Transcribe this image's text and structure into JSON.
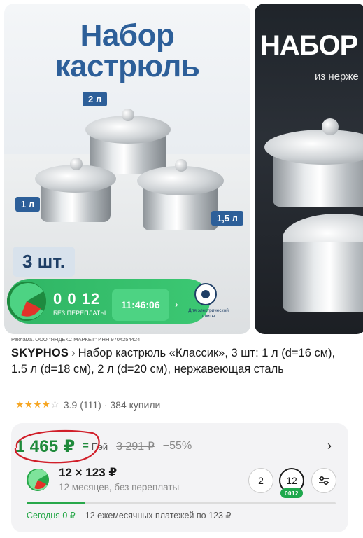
{
  "gallery": {
    "slide1": {
      "title_line1": "Набор",
      "title_line2": "кастрюль",
      "size_tags": [
        "2 л",
        "1 л",
        "1,5 л"
      ],
      "pieces": "3 шт.",
      "promo": {
        "installments_count": "0 0 12",
        "installments_subtitle": "БЕЗ ПЕРЕПЛАТЫ",
        "timer": "11:46:06",
        "plate_label": "Для электрической плиты"
      }
    },
    "slide2": {
      "title": "НАБОР К",
      "subtitle": "из нерже"
    }
  },
  "ad_disclaimer": "Реклама. ООО \"ЯНДЕКС МАРКЕТ\" ИНН 9704254424",
  "product": {
    "brand": "SKYPHOS",
    "breadcrumb_sep": "›",
    "title": "Набор кастрюль «Классик», 3 шт: 1 л (d=16 см), 1.5 л (d=18 см), 2 л (d=20 см), нержавеющая сталь",
    "rating": {
      "value": 3.9,
      "value_text": "3.9",
      "reviews": "(111)",
      "bought": "· 384 купили"
    }
  },
  "price": {
    "current": "1 465 ₽",
    "pay_label": "Пэй",
    "old": "3 291 ₽",
    "discount": "−55%",
    "chevron": "›"
  },
  "installment": {
    "main": "12 × 123 ₽",
    "sub": "12 месяцев, без переплаты",
    "terms": [
      "2",
      "12"
    ],
    "selected_term": "12",
    "badge": "0012",
    "progress_fraction": 0.19,
    "today": "Сегодня 0 ₽",
    "schedule": "12 ежемесячных платежей по 123 ₽"
  },
  "colors": {
    "accent_green": "#28a84a",
    "price_green": "#1f8a3b",
    "title_blue": "#2d5f99",
    "annotation_red": "#d11f2a"
  }
}
